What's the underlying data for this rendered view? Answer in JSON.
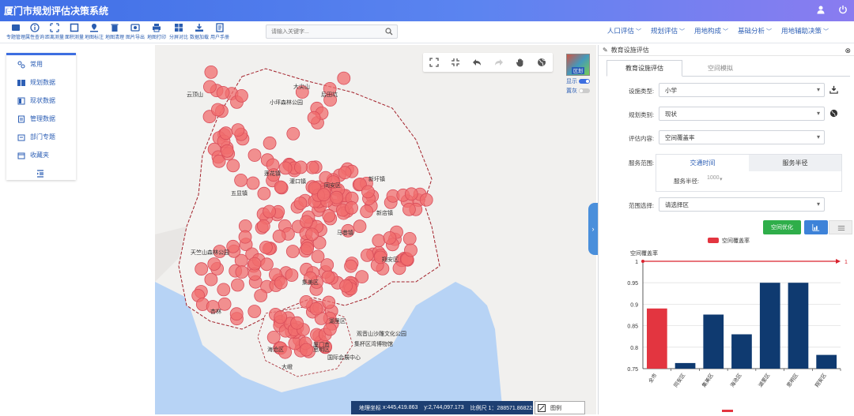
{
  "app": {
    "title": "厦门市规划评估决策系统"
  },
  "toolbar": {
    "tools": [
      "专题管理",
      "属性查询",
      "距离测量",
      "面积测量",
      "地图标注",
      "地图清理",
      "图片导出",
      "地图打印",
      "分屏对比",
      "数据加载",
      "用户手册"
    ]
  },
  "search": {
    "placeholder": "请输入关键字..."
  },
  "menus": [
    "人口评估",
    "规划评估",
    "用地构成",
    "基础分析",
    "用地辅助决策"
  ],
  "left_panel": {
    "items": [
      "常用",
      "规划数据",
      "现状数据",
      "管理数据",
      "部门专题",
      "收藏夹"
    ]
  },
  "layer_switch": {
    "thumb_label": "区划",
    "show_label": "显示",
    "gray_label": "置灰"
  },
  "map": {
    "places": [
      "云顶山",
      "大尖山",
      "小坪森林公园",
      "后田坑",
      "天竺山森林公园",
      "莲花镇",
      "五显镇",
      "灌口镇",
      "同安区",
      "新圩镇",
      "马巷镇",
      "翔安区",
      "新店镇",
      "集美区",
      "杏林",
      "湖里区",
      "思明区",
      "海沧区",
      "厦门市",
      "观音山沙雕文化公园",
      "集杯区湾博物馆",
      "国际会展中心",
      "大嶝"
    ],
    "status": {
      "coord_label": "地理坐标",
      "x": "x:445,419.863",
      "y": "y:2,744,097.173",
      "scale": "比例尺 1：288571.868221"
    },
    "legend_label": "图例"
  },
  "right_panel": {
    "header": "教育设施评估",
    "tabs": [
      "教育设施评估",
      "空间模拟"
    ],
    "fields": {
      "facility_type": {
        "label": "设施类型:",
        "value": "小学"
      },
      "planning_type": {
        "label": "规划类别:",
        "value": "现状"
      },
      "content": {
        "label": "评估内容:",
        "value": "空间覆盖率"
      },
      "service_range": {
        "label": "服务范围:",
        "seg1": "交通时间",
        "seg2": "服务半径"
      },
      "radius": {
        "label": "服务半径:",
        "value": "1000"
      },
      "area": {
        "label": "范围选择:",
        "value": "请选择区"
      }
    },
    "optimize_label": "空间优化"
  },
  "chart_data": {
    "type": "bar",
    "title": "空间覆盖率",
    "legend": "空间覆盖率",
    "categories": [
      "全市",
      "同安区",
      "集美区",
      "海沧区",
      "湖里区",
      "思明区",
      "翔安区"
    ],
    "values": [
      0.89,
      0.763,
      0.876,
      0.83,
      0.95,
      0.95,
      0.782
    ],
    "colors": [
      "#e33540",
      "#0f3a70",
      "#0f3a70",
      "#0f3a70",
      "#0f3a70",
      "#0f3a70",
      "#0f3a70"
    ],
    "ylim": [
      0.75,
      1
    ],
    "yticks": [
      "1",
      "0.95",
      "0.9",
      "0.85",
      "0.8",
      "0.75"
    ],
    "markline": {
      "value": 1,
      "label": "1"
    }
  }
}
